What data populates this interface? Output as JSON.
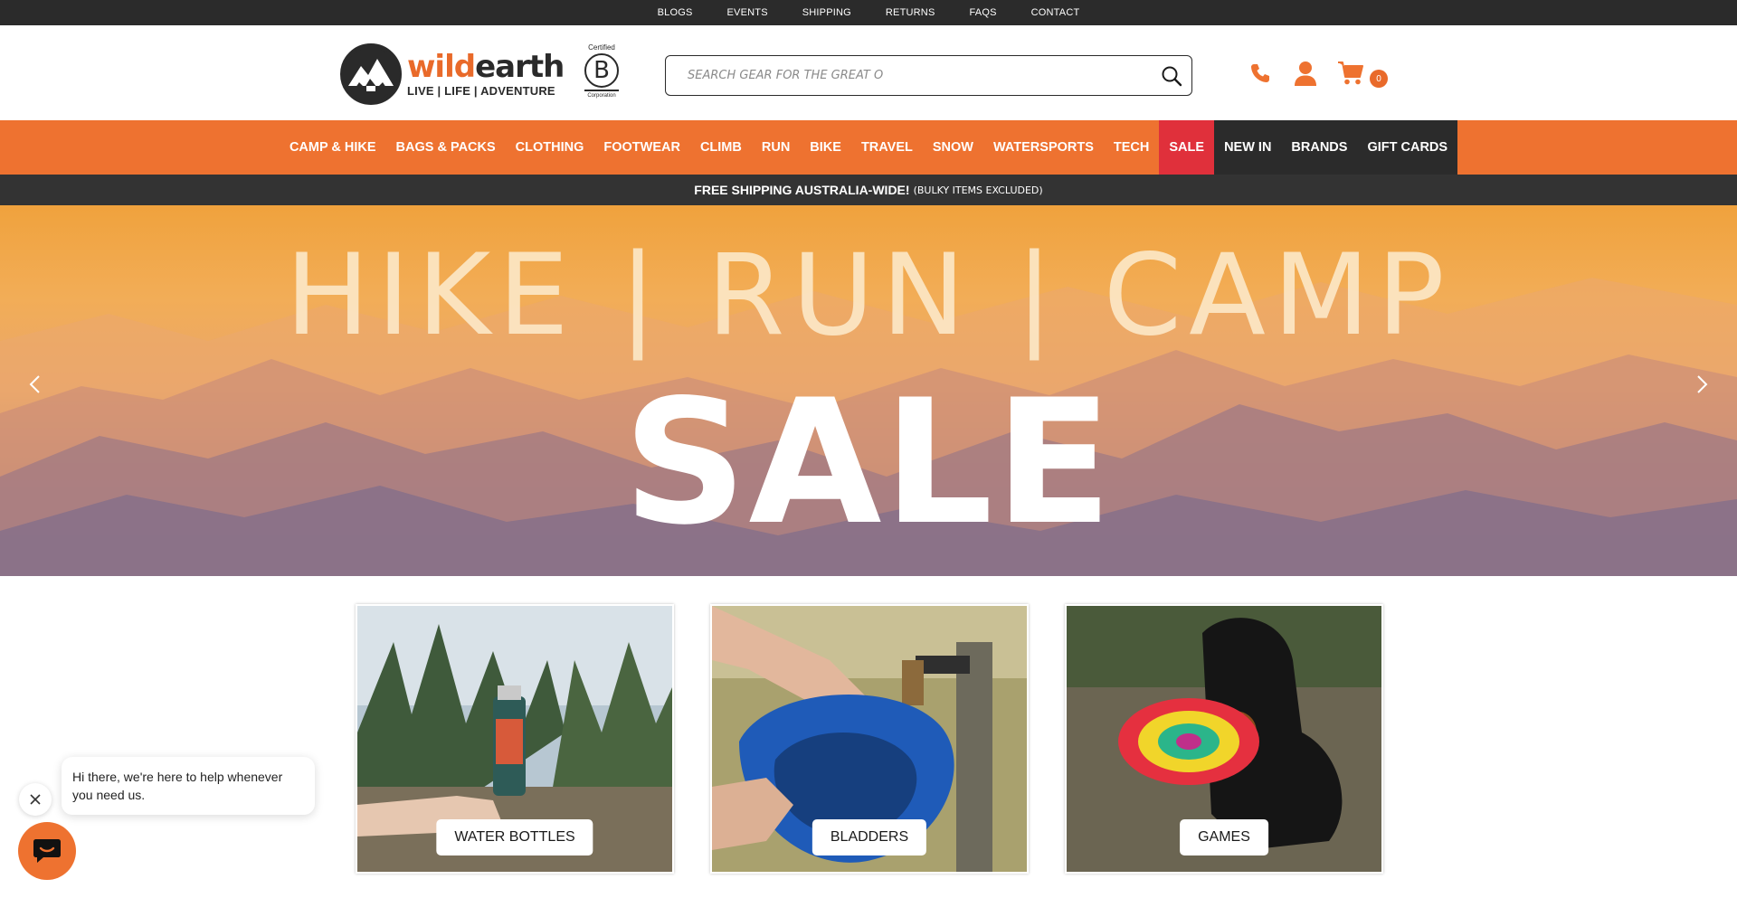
{
  "utility_nav": [
    "BLOGS",
    "EVENTS",
    "SHIPPING",
    "RETURNS",
    "FAQS",
    "CONTACT"
  ],
  "logo": {
    "part1": "wild",
    "part2": "earth",
    "tagline": "LIVE | LIFE | ADVENTURE"
  },
  "bcorp": {
    "top": "Certified",
    "letter": "B",
    "bottom": "Corporation"
  },
  "search": {
    "placeholder": "SEARCH GEAR FOR THE GREAT O"
  },
  "cart": {
    "count": "0"
  },
  "main_nav": [
    "CAMP & HIKE",
    "BAGS & PACKS",
    "CLOTHING",
    "FOOTWEAR",
    "CLIMB",
    "RUN",
    "BIKE",
    "TRAVEL",
    "SNOW",
    "WATERSPORTS",
    "TECH"
  ],
  "sale_label": "SALE",
  "dark_nav": [
    "NEW IN",
    "BRANDS",
    "GIFT CARDS"
  ],
  "shipping": {
    "main": "FREE SHIPPING AUSTRALIA-WIDE!",
    "note": "(BULKY ITEMS EXCLUDED)"
  },
  "hero": {
    "line1": "HIKE | RUN | CAMP",
    "line2": "SALE"
  },
  "tiles": [
    {
      "label": "WATER BOTTLES"
    },
    {
      "label": "BLADDERS"
    },
    {
      "label": "GAMES"
    }
  ],
  "chat": {
    "message": "Hi there, we're here to help whenever you need us."
  },
  "colors": {
    "accent": "#ee7230",
    "sale": "#e0303b",
    "dark": "#2b2b2b"
  },
  "icons": [
    "search-icon",
    "phone-icon",
    "account-icon",
    "cart-icon",
    "chevron-left-icon",
    "chevron-right-icon",
    "close-icon",
    "chat-icon"
  ]
}
